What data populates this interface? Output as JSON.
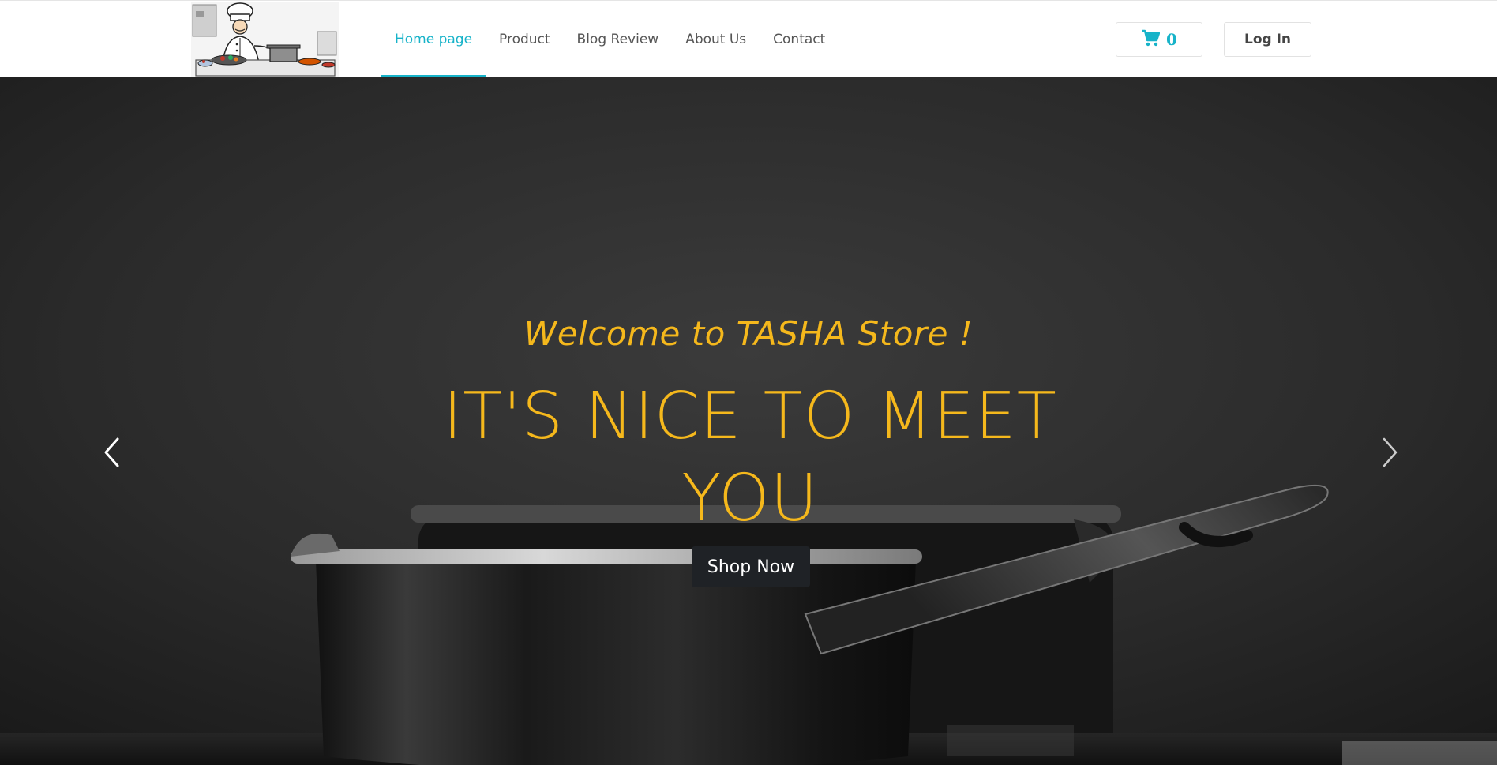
{
  "header": {
    "logo_alt": "chef logo",
    "nav": [
      {
        "label": "Home page",
        "active": true
      },
      {
        "label": "Product",
        "active": false
      },
      {
        "label": "Blog Review",
        "active": false
      },
      {
        "label": "About Us",
        "active": false
      },
      {
        "label": "Contact",
        "active": false
      }
    ],
    "cart": {
      "icon": "cart-icon",
      "count": "0"
    },
    "login_label": "Log In"
  },
  "hero": {
    "welcome": "Welcome to TASHA Store !",
    "headline": "IT'S NICE TO MEET YOU",
    "cta_label": "Shop Now",
    "prev_icon": "chevron-left-icon",
    "next_icon": "chevron-right-icon"
  },
  "colors": {
    "accent": "#17b3c9",
    "hero_text": "#f5b81c",
    "button_dark": "#1f2226"
  }
}
